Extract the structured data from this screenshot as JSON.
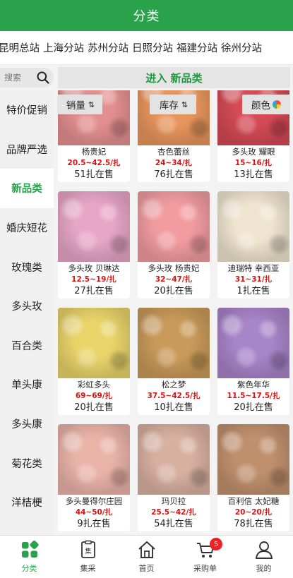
{
  "header": {
    "title": "分类"
  },
  "stations": [
    "昆明总站",
    "上海分站",
    "苏州分站",
    "日照分站",
    "福建分站",
    "徐州分站"
  ],
  "search": {
    "placeholder": "搜索"
  },
  "enter_new_label": "进入 新品类",
  "sidebar": {
    "items": [
      {
        "label": "特价促销",
        "active": false
      },
      {
        "label": "品牌严选",
        "active": false
      },
      {
        "label": "新品类",
        "active": true
      },
      {
        "label": "婚庆短花",
        "active": false
      },
      {
        "label": "玫瑰类",
        "active": false
      },
      {
        "label": "多头玫",
        "active": false
      },
      {
        "label": "百合类",
        "active": false
      },
      {
        "label": "单头康",
        "active": false
      },
      {
        "label": "多头康",
        "active": false
      },
      {
        "label": "菊花类",
        "active": false
      },
      {
        "label": "洋桔梗",
        "active": false
      }
    ]
  },
  "sort": {
    "sales": "销量",
    "stock": "库存",
    "color": "颜色",
    "swap_glyph": "⇅"
  },
  "products": [
    {
      "name": "杨贵妃",
      "price": "20.5~42.5/扎",
      "sale": "51扎在售",
      "color": "#e48f8f"
    },
    {
      "name": "杏色蕾丝",
      "price": "24~34/扎",
      "sale": "76扎在售",
      "color": "#e8955c"
    },
    {
      "name": "多头玫 耀眼",
      "price": "15~16/扎",
      "sale": "13扎在售",
      "color": "#d44a55"
    },
    {
      "name": "多头玫 贝琳达",
      "price": "12.5~19/扎",
      "sale": "27扎在售",
      "color": "#e7a6c6"
    },
    {
      "name": "多头玫 杨贵妃",
      "price": "32~47/扎",
      "sale": "20扎在售",
      "color": "#f29ca0"
    },
    {
      "name": "迪瑞特 幸西亚",
      "price": "31~31/扎",
      "sale": "1扎在售",
      "color": "#efe4cf"
    },
    {
      "name": "彩虹多头",
      "price": "69~69/扎",
      "sale": "20扎在售",
      "color": "#e9d46a"
    },
    {
      "name": "松之梦",
      "price": "37.5~42.5/扎",
      "sale": "10扎在售",
      "color": "#c99a5a"
    },
    {
      "name": "紫色年华",
      "price": "11.5~17.5/扎",
      "sale": "20扎在售",
      "color": "#a884c9"
    },
    {
      "name": "多头曼得尔庄园",
      "price": "44~50/扎",
      "sale": "9扎在售",
      "color": "#eab3a8"
    },
    {
      "name": "玛贝拉",
      "price": "25.5~42/扎",
      "sale": "54扎在售",
      "color": "#d8b0a0"
    },
    {
      "name": "百利信 太妃糖",
      "price": "20~20/扎",
      "sale": "78扎在售",
      "color": "#c0906d"
    }
  ],
  "tabs": [
    {
      "label": "分类",
      "icon": "category-icon",
      "active": true
    },
    {
      "label": "集采",
      "icon": "group-buy-icon",
      "active": false
    },
    {
      "label": "首页",
      "icon": "home-icon",
      "active": false
    },
    {
      "label": "采购单",
      "icon": "cart-icon",
      "active": false,
      "badge": "5"
    },
    {
      "label": "我的",
      "icon": "user-icon",
      "active": false
    }
  ],
  "colors": {
    "brand_green": "#2aa14b",
    "price_red": "#dd1111",
    "badge_red": "#ee2222"
  }
}
